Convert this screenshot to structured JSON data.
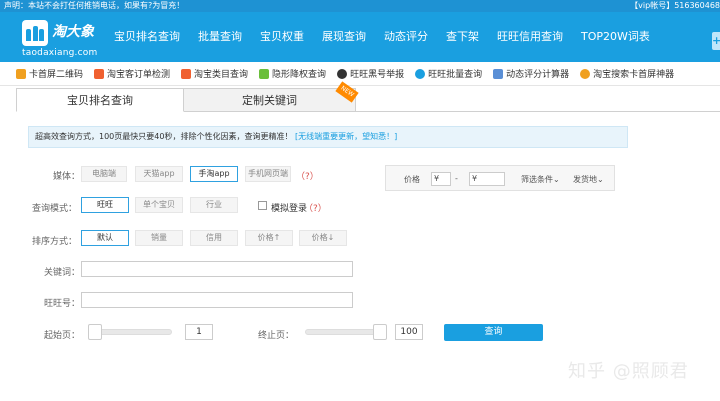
{
  "notice": {
    "text": "声明：本站不会打任何推销电话，如果有?为冒充！",
    "vip": "【vip帐号】516360468"
  },
  "logo": {
    "name": "淘大象",
    "domain": "taodaxiang.com"
  },
  "nav": [
    "宝贝排名查询",
    "批量查询",
    "宝贝权重",
    "展现查询",
    "动态评分",
    "查下架",
    "旺旺信用查询",
    "TOP20W词表"
  ],
  "side_tab": "+",
  "tools": [
    {
      "label": "卡首屏二维码",
      "icon": "qrcode-icon",
      "color": "#f0a020"
    },
    {
      "label": "淘宝客订单检测",
      "icon": "taobao-icon",
      "color": "#f06030"
    },
    {
      "label": "淘宝类目查询",
      "icon": "taobao-icon",
      "color": "#f06030"
    },
    {
      "label": "隐形降权查询",
      "icon": "shield-icon",
      "color": "#6abf3a"
    },
    {
      "label": "旺旺黑号举报",
      "icon": "face-icon",
      "color": "#333333"
    },
    {
      "label": "旺旺批量查询",
      "icon": "ww-icon",
      "color": "#1a9fe0"
    },
    {
      "label": "动态评分计算器",
      "icon": "calculator-icon",
      "color": "#5a8fd6"
    },
    {
      "label": "淘宝搜索卡首屏神器",
      "icon": "smile-icon",
      "color": "#f0a020"
    }
  ],
  "tabs": {
    "active": "宝贝排名查询",
    "inactive": "定制关键词",
    "badge": "NEW"
  },
  "info": {
    "text": "超高效查询方式，100页最快只要40秒，排除个性化因素，查询更精准！",
    "link": "[无线端重要更新，望知悉！]"
  },
  "form": {
    "media_label": "媒体：",
    "media_options": [
      "电脑端",
      "天猫app",
      "手淘app",
      "手机网页端"
    ],
    "media_hint": "（?）",
    "mode_label": "查询模式：",
    "mode_options": [
      "旺旺",
      "单个宝贝",
      "行业"
    ],
    "simulate_label": "模拟登录",
    "simulate_hint": "（?）",
    "sort_label": "排序方式：",
    "sort_options": [
      "默认",
      "销量",
      "信用",
      "价格↑",
      "价格↓"
    ],
    "keyword_label": "关键词：",
    "ww_label": "旺旺号：",
    "start_label": "起始页：",
    "start_value": "1",
    "end_label": "终止页：",
    "end_value": "100",
    "submit_label": "查询"
  },
  "price": {
    "label": "价格",
    "min_placeholder": "¥",
    "sep": "-",
    "max_placeholder": "¥",
    "filter": "筛选条件",
    "ship": "发货地"
  },
  "watermark": "知乎 @照顾君"
}
